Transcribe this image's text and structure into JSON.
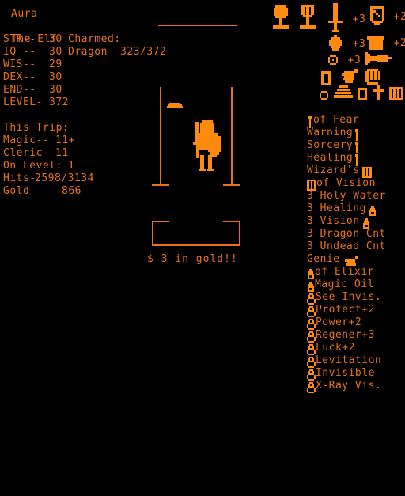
{
  "theme": {
    "background": "#000000",
    "text_color": "#e8701c",
    "sprite_color": "#ff8a10"
  },
  "character": {
    "name": "Aura",
    "class_line": "The Elf",
    "stats": [
      {
        "label": "STR--",
        "value": "30"
      },
      {
        "label": "IQ --",
        "value": "30"
      },
      {
        "label": "WIS--",
        "value": "29"
      },
      {
        "label": "DEX--",
        "value": "30"
      },
      {
        "label": "END--",
        "value": "30"
      },
      {
        "label": "LEVEL-",
        "value": "372"
      }
    ],
    "charmed": {
      "header": "Charmed:",
      "monster": "Dragon",
      "hits": "323/372"
    },
    "trip": {
      "header": "This Trip:",
      "magic_label": "Magic--",
      "magic_value": "11+",
      "cleric_label": "Cleric-",
      "cleric_value": "11",
      "on_level_label": "On Level:",
      "on_level_value": "1",
      "hits_label": "Hits-",
      "hits_value": "2598/3134",
      "gold_label": "Gold-",
      "gold_value": "866"
    }
  },
  "viewport": {
    "message": "$ 3 in gold!!",
    "floor_item": "gold-pile",
    "player_sprite": "knight-with-sword-and-shield"
  },
  "inventory": {
    "trophies": [
      {
        "icon": "orb-pedestal-icon"
      },
      {
        "icon": "chalice-pedestal-icon"
      }
    ],
    "equipment": [
      {
        "icon": "sword-icon",
        "label": "+3"
      },
      {
        "icon": "shield-icon",
        "label": "+2"
      },
      {
        "icon": "helmet-icon",
        "label": "+3"
      },
      {
        "icon": "armor-icon",
        "label": "+2"
      },
      {
        "icon": "ring-icon",
        "label": "+3"
      },
      {
        "icon": "crossbow-icon",
        "label": ""
      }
    ],
    "misc_icons_row1": [
      {
        "icon": "gem-box-icon"
      },
      {
        "icon": "genie-lamp-icon"
      },
      {
        "icon": "scroll-hand-icon"
      }
    ],
    "misc_icons_row2": [
      {
        "icon": "small-ring-icon"
      },
      {
        "icon": "boat-scroll-icon"
      },
      {
        "icon": "flask-box-icon"
      },
      {
        "icon": "cross-icon"
      },
      {
        "icon": "book-icon"
      }
    ],
    "items": [
      {
        "icon": "wand-icon",
        "icon_side": "left",
        "label": "of Fear"
      },
      {
        "icon": "wand-icon",
        "icon_side": "right",
        "label": "Warning"
      },
      {
        "icon": "wand-icon",
        "icon_side": "right",
        "label": "Sorcery"
      },
      {
        "icon": "wand-icon",
        "icon_side": "right",
        "label": "Healing"
      },
      {
        "icon": "scroll-icon",
        "icon_side": "right",
        "label": "Wizard's"
      },
      {
        "icon": "scroll-icon",
        "icon_side": "left",
        "label": "of Vision"
      },
      {
        "icon": "none",
        "icon_side": "none",
        "label": "3 Holy Water"
      },
      {
        "icon": "potion-icon",
        "icon_side": "right",
        "label": "3 Healing"
      },
      {
        "icon": "potion-icon",
        "icon_side": "right",
        "label": "3 Vision"
      },
      {
        "icon": "none",
        "icon_side": "none",
        "label": "3 Dragon Cnt"
      },
      {
        "icon": "none",
        "icon_side": "none",
        "label": "3 Undead Cnt"
      },
      {
        "icon": "lamp-icon",
        "icon_side": "right",
        "label": "Genie"
      },
      {
        "icon": "potion-icon",
        "icon_side": "left",
        "label": "of Elixir"
      },
      {
        "icon": "potion-icon",
        "icon_side": "left",
        "label": "Magic Oil"
      },
      {
        "icon": "ring-icon",
        "icon_side": "left",
        "label": "See Invis."
      },
      {
        "icon": "ring-icon",
        "icon_side": "left",
        "label": "Protect+2"
      },
      {
        "icon": "ring-icon",
        "icon_side": "left",
        "label": "Power+2"
      },
      {
        "icon": "ring-icon",
        "icon_side": "left",
        "label": "Regener+3"
      },
      {
        "icon": "ring-icon",
        "icon_side": "left",
        "label": "Luck+2"
      },
      {
        "icon": "ring-icon",
        "icon_side": "left",
        "label": "Levitation"
      },
      {
        "icon": "ring-icon",
        "icon_side": "left",
        "label": "Invisible"
      },
      {
        "icon": "ring-icon",
        "icon_side": "left",
        "label": "X-Ray Vis."
      }
    ]
  }
}
